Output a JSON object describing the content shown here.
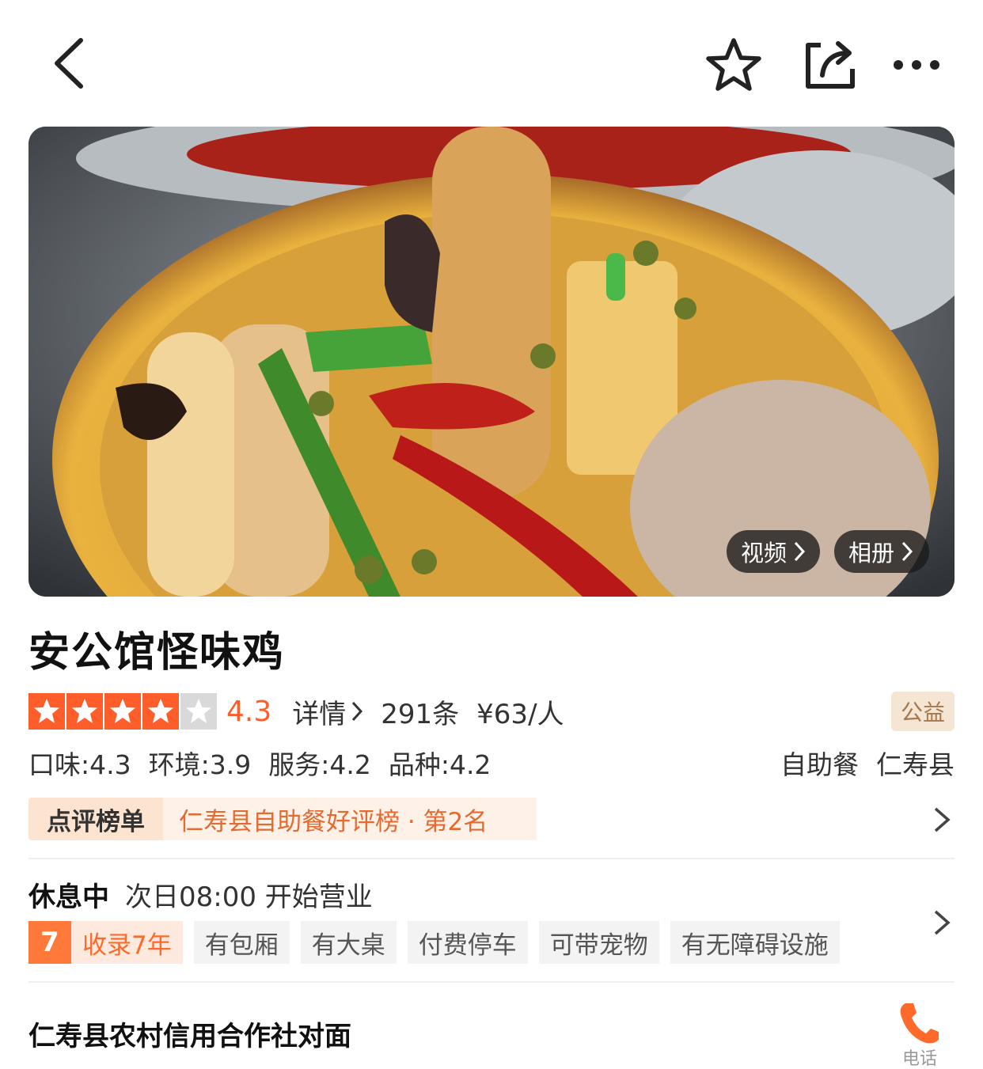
{
  "nav": {
    "back": "back-icon",
    "favorite": "star-icon",
    "share": "share-icon",
    "more": "more-icon"
  },
  "hero": {
    "video_label": "视频",
    "album_label": "相册"
  },
  "shop": {
    "name": "安公馆怪味鸡",
    "rating_stars": 4,
    "score": "4.3",
    "detail_label": "详情",
    "review_count": "291条",
    "price": "¥63/人",
    "charity_badge": "公益",
    "sub_scores": [
      "口味:4.3",
      "环境:3.9",
      "服务:4.2",
      "品种:4.2"
    ],
    "category": "自助餐",
    "district": "仁寿县"
  },
  "ranking": {
    "label": "点评榜单",
    "text": "仁寿县自助餐好评榜 · 第2名"
  },
  "status": {
    "state": "休息中",
    "hours": "次日08:00 开始营业"
  },
  "tags": {
    "years_num": "7",
    "years_text": "收录7年",
    "items": [
      "有包厢",
      "有大桌",
      "付费停车",
      "可带宠物",
      "有无障碍设施"
    ]
  },
  "address": {
    "text": "仁寿县农村信用合作社对面",
    "phone_label": "电话"
  },
  "colors": {
    "accent": "#ff5d2a",
    "rank_text": "#e46a30"
  }
}
